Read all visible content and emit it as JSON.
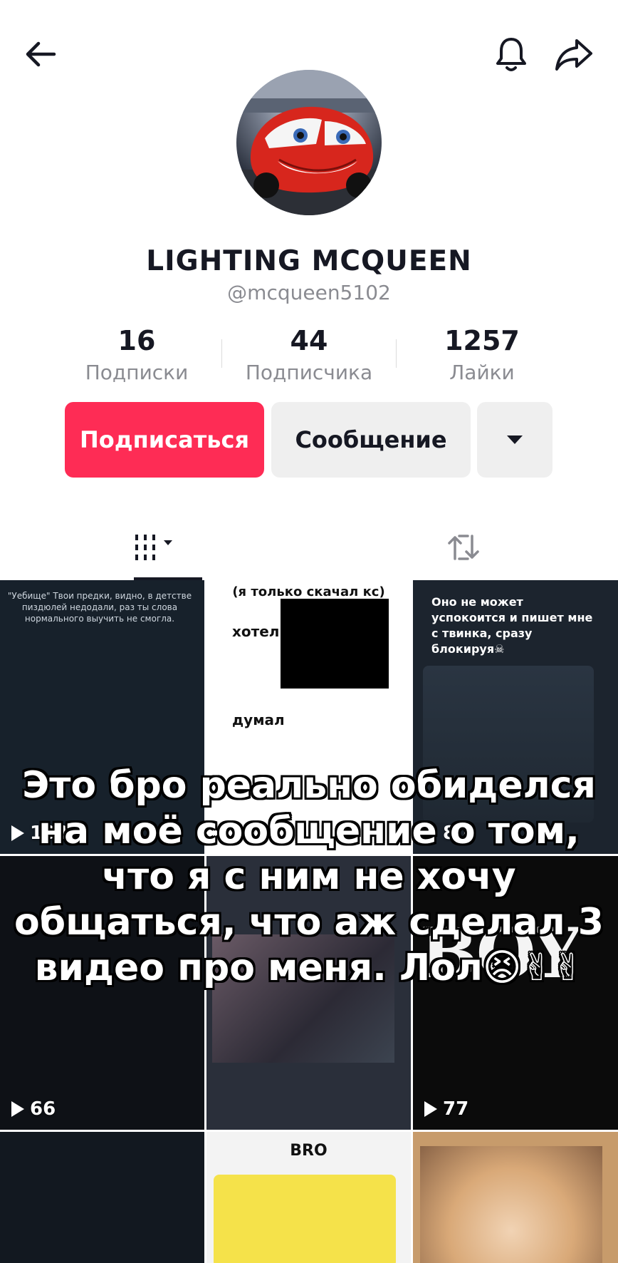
{
  "profile": {
    "display_name": "LIGHTING MCQUEEN",
    "handle": "@mcqueen5102",
    "stats": [
      {
        "value": "16",
        "label": "Подписки"
      },
      {
        "value": "44",
        "label": "Подписчика"
      },
      {
        "value": "1257",
        "label": "Лайки"
      }
    ]
  },
  "actions": {
    "follow_label": "Подписаться",
    "message_label": "Сообщение"
  },
  "colors": {
    "follow": "#fe2c55",
    "secondary_bg": "#efefef",
    "muted": "#8a8b91"
  },
  "icons": {
    "back": "arrow-left-icon",
    "notifications": "bell-icon",
    "share": "share-arrow-icon",
    "more": "caret-down-icon",
    "videos_tab": "grid-icon",
    "reposts_tab": "repost-icon"
  },
  "grid": [
    {
      "views": "103",
      "caption": "\"Уебище\" Твои предки, видно, в детстве пиздюлей недодали, раз ты слова нормального выучить не смогла."
    },
    {
      "views": "177",
      "caption_top": "(я только скачал кс)",
      "word1": "хотел",
      "word2": "думал"
    },
    {
      "views": "80",
      "caption": "Оно не может успокоится и пишет мне с твинка, сразу блокируя☠"
    },
    {
      "views": "66"
    },
    {
      "views": ""
    },
    {
      "views": "77"
    },
    {
      "views": ""
    },
    {
      "views": "",
      "caption": "BRO"
    },
    {
      "views": ""
    }
  ],
  "overlay_text": "Это бро реально обиделся на моё сообщение о том, что я с ним не хочу общаться, что аж сделал 3 видео про меня. Лол😣✌✌"
}
